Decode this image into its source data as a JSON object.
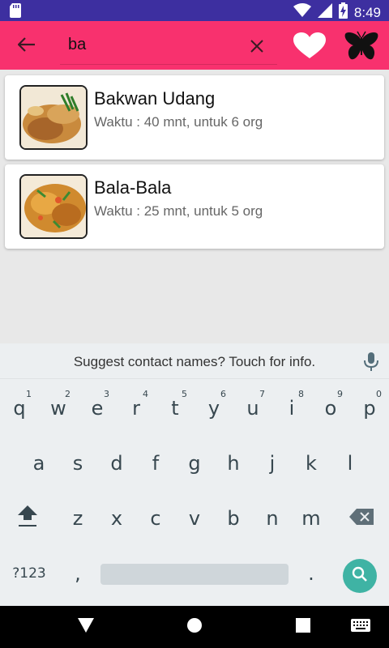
{
  "status_bar": {
    "time": "8:49",
    "icons": [
      "sd-card-icon",
      "wifi-icon",
      "signal-icon",
      "battery-charging-icon"
    ]
  },
  "app_bar": {
    "background": "#f8316e",
    "search_value": "ba",
    "icons": [
      "back-arrow-icon",
      "clear-icon",
      "heart-icon",
      "butterfly-icon"
    ]
  },
  "results": [
    {
      "title": "Bakwan Udang",
      "meta": "Waktu : 40 mnt, untuk 6 org"
    },
    {
      "title": "Bala-Bala",
      "meta": "Waktu : 25 mnt, untuk 5 org"
    }
  ],
  "keyboard": {
    "suggestion": "Suggest contact names? Touch for info.",
    "row1": [
      {
        "k": "q",
        "h": "1"
      },
      {
        "k": "w",
        "h": "2"
      },
      {
        "k": "e",
        "h": "3"
      },
      {
        "k": "r",
        "h": "4"
      },
      {
        "k": "t",
        "h": "5"
      },
      {
        "k": "y",
        "h": "6"
      },
      {
        "k": "u",
        "h": "7"
      },
      {
        "k": "i",
        "h": "8"
      },
      {
        "k": "o",
        "h": "9"
      },
      {
        "k": "p",
        "h": "0"
      }
    ],
    "row2": [
      "a",
      "s",
      "d",
      "f",
      "g",
      "h",
      "j",
      "k",
      "l"
    ],
    "row3": [
      "z",
      "x",
      "c",
      "v",
      "b",
      "n",
      "m"
    ],
    "symbols_label": "?123",
    "comma": ",",
    "period": ".",
    "search_key_color": "#3fb3a4"
  },
  "nav_bar": {
    "icons": [
      "back-triangle-icon",
      "home-circle-icon",
      "recents-square-icon",
      "keyboard-icon"
    ]
  }
}
